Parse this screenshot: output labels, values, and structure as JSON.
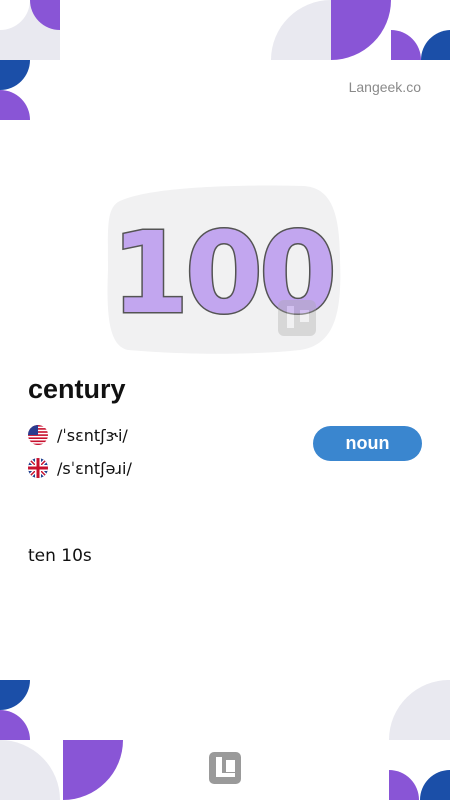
{
  "site": {
    "name": "Langeek.co"
  },
  "illustration": {
    "number": "100"
  },
  "entry": {
    "word": "century",
    "pronunciations": [
      {
        "region": "us",
        "ipa": "/ˈsɛntʃɝi/"
      },
      {
        "region": "uk",
        "ipa": "/sˈɛntʃəɹi/"
      }
    ],
    "part_of_speech": "noun",
    "definition": "ten 10s"
  },
  "colors": {
    "purple": "#8955d6",
    "blue": "#1b4fa8",
    "light_gray": "#e9e9f0",
    "badge": "#3a86cf",
    "number_fill": "#c2a6ef",
    "number_stroke": "#545454"
  }
}
